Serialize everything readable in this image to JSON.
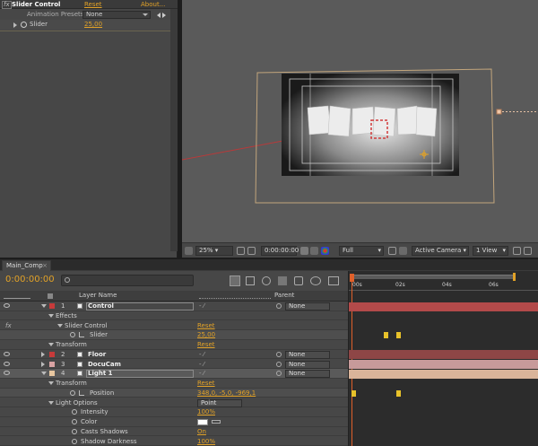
{
  "effect_controls": {
    "effect_name": "Slider Control",
    "reset_label": "Reset",
    "about_label": "About...",
    "fx_badge": "fx",
    "presets_label": "Animation Presets:",
    "presets_value": "None",
    "slider_label": "Slider",
    "slider_value": "25,00"
  },
  "viewer_bar": {
    "zoom": "25%",
    "timecode": "0:00:00:00",
    "resolution": "Full",
    "camera": "Active Camera",
    "views": "1 View"
  },
  "timeline": {
    "tab_label": "Main_Comp",
    "current_time": "0:00:00:00",
    "header": {
      "layer_name_col": "Layer Name",
      "parent_col": "Parent"
    },
    "ruler_ticks": [
      "00s",
      "02s",
      "04s",
      "06s"
    ],
    "rows": [
      {
        "kind": "layer",
        "num": "1",
        "name": "Control",
        "swatch": "#c73a3a",
        "parent": "None",
        "bar_color": "#b34a4a"
      },
      {
        "kind": "group",
        "label": "Effects"
      },
      {
        "kind": "effect",
        "label": "Slider Control",
        "value": "Reset"
      },
      {
        "kind": "prop",
        "label": "Slider",
        "value": "25,00"
      },
      {
        "kind": "group",
        "label": "Transform",
        "value": "Reset"
      },
      {
        "kind": "layer",
        "num": "2",
        "name": "Floor",
        "swatch": "#c73a3a",
        "parent": "None",
        "bar_color": "#8e4646"
      },
      {
        "kind": "layer",
        "num": "3",
        "name": "DocuCam",
        "swatch": "#d9a3a3",
        "parent": "None",
        "bar_color": "#c79a9a"
      },
      {
        "kind": "layer",
        "num": "4",
        "name": "Light 1",
        "swatch": "#e8c7a0",
        "parent": "None",
        "bar_color": "#d9b49a"
      },
      {
        "kind": "group",
        "label": "Transform",
        "value": "Reset"
      },
      {
        "kind": "prop",
        "label": "Position",
        "value": "348,0, -5,0, -969,1"
      },
      {
        "kind": "group",
        "label": "Light Options",
        "value": "Point"
      },
      {
        "kind": "subprop",
        "label": "Intensity",
        "value": "100%"
      },
      {
        "kind": "subprop",
        "label": "Color",
        "value": ""
      },
      {
        "kind": "subprop",
        "label": "Casts Shadows",
        "value": "On"
      },
      {
        "kind": "subprop",
        "label": "Shadow Darkness",
        "value": "100%"
      }
    ]
  },
  "colors": {
    "accent": "#e2a227",
    "playhead": "#e0602a",
    "keyframe": "#e8c22a"
  }
}
